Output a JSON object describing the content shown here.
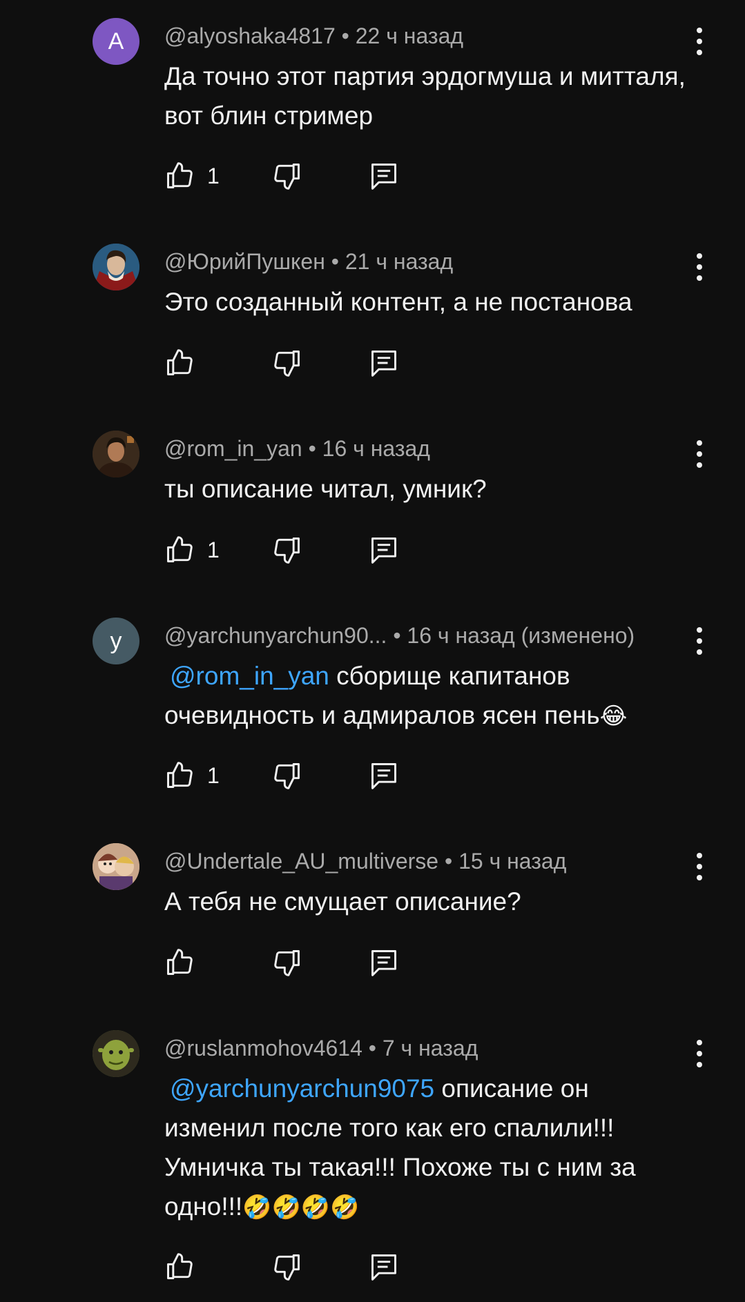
{
  "comments": [
    {
      "avatar_letter": "A",
      "avatar_color": "#7e57c2",
      "handle": "@alyoshaka4817",
      "time": "22 ч назад",
      "mention": "",
      "text": "Да точно этот партия эрдогмуша и митталя, вот блин стример",
      "emoji": "",
      "likes": "1"
    },
    {
      "avatar_letter": "",
      "avatar_color": "#1d4b6e",
      "handle": "@ЮрийПушкен",
      "time": "21 ч назад",
      "mention": "",
      "text": "Это созданный контент, а не постанова",
      "emoji": "",
      "likes": ""
    },
    {
      "avatar_letter": "",
      "avatar_color": "#3a2a1c",
      "handle": "@rom_in_yan",
      "time": "16 ч назад",
      "mention": "",
      "text": "ты описание читал, умник?",
      "emoji": "",
      "likes": "1"
    },
    {
      "avatar_letter": "у",
      "avatar_color": "#455a64",
      "handle": "@yarchunyarchun90...",
      "time": "16 ч назад (изменено)",
      "mention": "@rom_in_yan",
      "text": "сборище капитанов очевидность и адмиралов ясен пень",
      "emoji": "😂",
      "likes": "1"
    },
    {
      "avatar_letter": "",
      "avatar_color": "#c9a68a",
      "handle": "@Undertale_AU_multiverse",
      "time": "15 ч назад",
      "mention": "",
      "text": "А тебя не смущает описание?",
      "emoji": "",
      "likes": ""
    },
    {
      "avatar_letter": "",
      "avatar_color": "#6d7c3a",
      "handle": "@ruslanmohov4614",
      "time": "7 ч назад",
      "mention": "@yarchunyarchun9075",
      "text": "описание он изменил после того как его спалили!!! Умничка ты такая!!! Похоже ты с ним за одно!!!",
      "emoji": "🤣🤣🤣🤣",
      "likes": ""
    }
  ],
  "separator": "•",
  "icons": {
    "like": "thumbs-up-icon",
    "dislike": "thumbs-down-icon",
    "reply": "reply-comment-icon",
    "more": "more-vert-icon"
  }
}
